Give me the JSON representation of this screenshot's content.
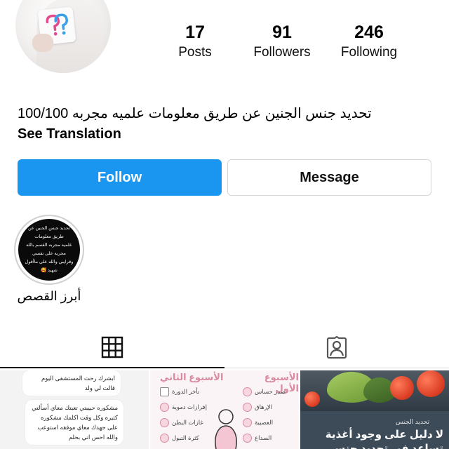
{
  "profile": {
    "stats": [
      {
        "value": "17",
        "label": "Posts"
      },
      {
        "value": "91",
        "label": "Followers"
      },
      {
        "value": "246",
        "label": "Following"
      }
    ],
    "bio": "تحديد جنس الجنين عن طريق معلومات علميه مجربه 100/100",
    "see_translation": "See Translation"
  },
  "actions": {
    "follow_label": "Follow",
    "message_label": "Message"
  },
  "highlight": {
    "label": "أبرز القصص",
    "cover_lines": [
      "تحديد جنس الجنين عن طريق معلومات",
      "علميه مجربه القسم بالله مجربه على نفسي",
      "وقرايبي والله على ماأقول شهيد 🥰"
    ]
  },
  "tabs": [
    {
      "name": "grid",
      "icon": "grid-icon"
    },
    {
      "name": "tagged",
      "icon": "tagged-person-icon"
    }
  ],
  "posts": {
    "post1": {
      "bubble1": "ابشرك رحت المستشفى اليوم قالت لي ولد",
      "bubble2": "مشكوره حبيبتي تعبتك معاي أسألتي كثيره وكل وقت اكلمك مشكوره على جهدك معاي موفقه استوعب والله احس اني بحلم"
    },
    "post2": {
      "week1_title": "الأسبوع الأول",
      "week2_title": "الأسبوع الثاني",
      "week1_items": [
        "صدر حساس",
        "الإرهاق",
        "العصبية",
        "الصداع"
      ],
      "week2_items": [
        "تأخر الدورة",
        "إفرازات دموية",
        "غازات البطن",
        "كثرة التبول"
      ]
    },
    "post3": {
      "tag": "تحديد الجنس",
      "title": "لا دليل على وجود أغذية تساعد في تحديد جنس الجنين"
    }
  },
  "colors": {
    "follow_blue": "#1a96f0",
    "pink_accent": "#d98aa0"
  }
}
